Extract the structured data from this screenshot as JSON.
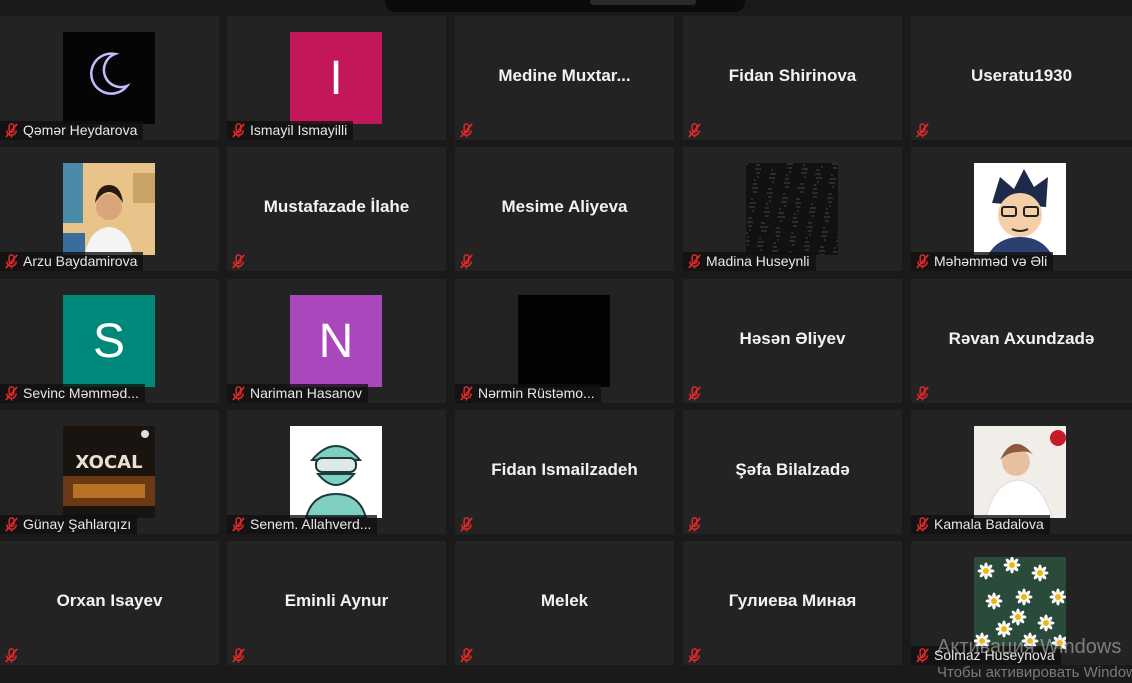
{
  "window": {
    "title": ""
  },
  "participants": [
    {
      "name": "Qəmər Heydarova",
      "mode": "image",
      "img": "moon"
    },
    {
      "name": "Ismayil Ismayilli",
      "mode": "letter",
      "letter": "I",
      "color": "#c2185b"
    },
    {
      "name": "Medine  Muxtar...",
      "mode": "text"
    },
    {
      "name": "Fidan Shirinova",
      "mode": "text"
    },
    {
      "name": "Useratu1930",
      "mode": "text"
    },
    {
      "name": "Arzu Baydamirova",
      "mode": "image",
      "img": "woman-photo"
    },
    {
      "name": "Mustafazade İlahe",
      "mode": "text"
    },
    {
      "name": "Mesime Aliyeva",
      "mode": "text"
    },
    {
      "name": "Madina Huseynli",
      "mode": "image",
      "img": "dark-texture"
    },
    {
      "name": "Məhəmməd və Əli",
      "mode": "image",
      "img": "cartoon"
    },
    {
      "name": "Sevinc Məmmədova",
      "mode": "letter",
      "letter": "S",
      "color": "#00897b"
    },
    {
      "name": "Nariman Hasanov",
      "mode": "letter",
      "letter": "N",
      "color": "#ab47bc"
    },
    {
      "name": "Nərmin Rüstəmov",
      "mode": "image",
      "img": "black"
    },
    {
      "name": "Həsən Əliyev",
      "mode": "text"
    },
    {
      "name": "Rəvan Axundzadə",
      "mode": "text"
    },
    {
      "name": "Günay Şahlarqızı",
      "mode": "image",
      "img": "poster"
    },
    {
      "name": "Senem. Allahverdiyeva",
      "mode": "image",
      "img": "surgeon"
    },
    {
      "name": "Fidan Ismailzadeh",
      "mode": "text"
    },
    {
      "name": "Şəfa Bilalzadə",
      "mode": "text"
    },
    {
      "name": "Kamala Badalova",
      "mode": "image",
      "img": "woman-portrait"
    },
    {
      "name": "Orxan Isayev",
      "mode": "text"
    },
    {
      "name": "Eminli Aynur",
      "mode": "text"
    },
    {
      "name": "Melek",
      "mode": "text"
    },
    {
      "name": "Гулиева Миная",
      "mode": "text"
    },
    {
      "name": "Solmaz Huseynova",
      "mode": "image",
      "img": "daisies"
    }
  ],
  "labels": [
    "Qəmər Heydarova",
    "Ismayil Ismayilli",
    "",
    "",
    "",
    "Arzu Baydamirova",
    "",
    "",
    "Madina Huseynli",
    "Məhəmməd və Əli",
    "Sevinc Məmməd...",
    "Nariman Hasanov",
    "Nərmin Rüstəmo...",
    "",
    "",
    "Günay Şahlarqızı",
    "Senem. Allahverd...",
    "",
    "",
    "Kamala Badalova",
    "",
    "",
    "",
    "",
    "Solmaz Huseynova"
  ],
  "watermark": {
    "line1": "Активация Windows",
    "line2": "Чтобы активировать Windows"
  },
  "colors": {
    "tile": "#232323",
    "gap": "#1a1a1a",
    "mic_muted": "#e02828"
  }
}
